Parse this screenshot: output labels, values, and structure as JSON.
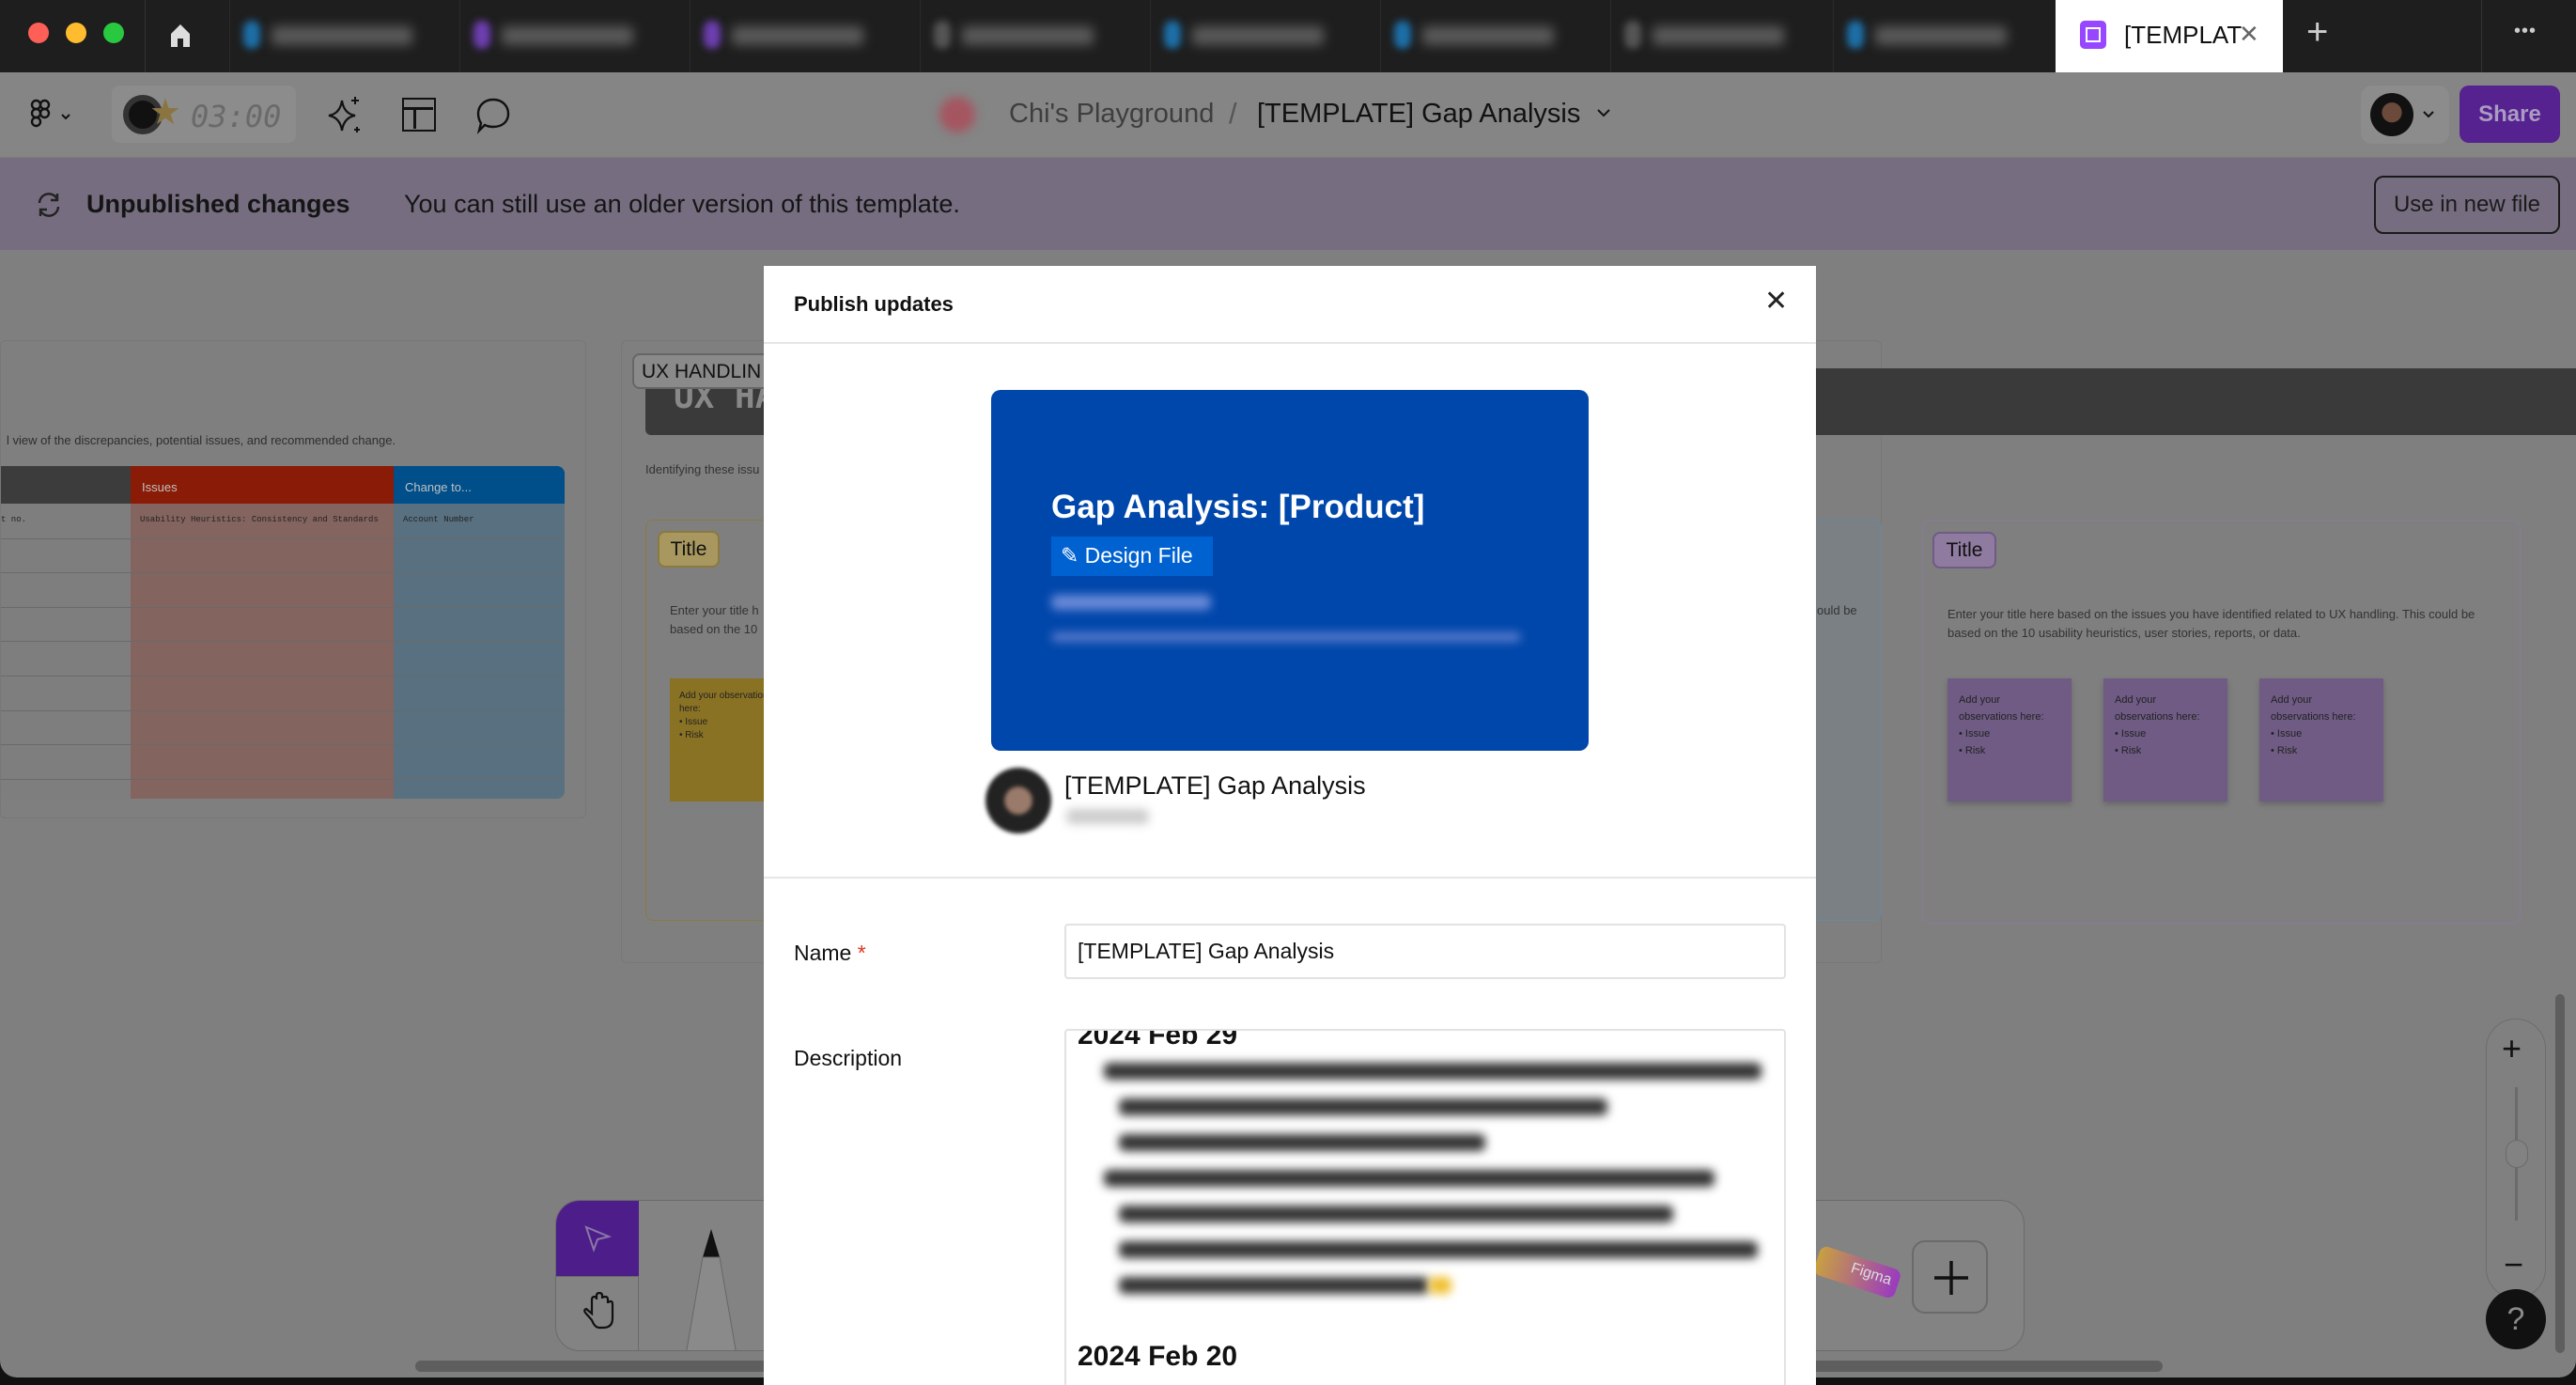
{
  "browser": {
    "active_tab": {
      "label": "[TEMPLAT",
      "close": "✕"
    },
    "new_tab": "+",
    "more": "•••"
  },
  "toolbar": {
    "timer": "03:00",
    "breadcrumb": {
      "team": "Chi's Playground",
      "separator": "/",
      "file": "[TEMPLATE] Gap Analysis"
    },
    "share_label": "Share"
  },
  "banner": {
    "title": "Unpublished changes",
    "message": "You can still use an older version of this template.",
    "use_button": "Use in new file"
  },
  "canvas": {
    "left_frame": {
      "subtitle": "l view of the discrepancies, potential issues, and recommended change.",
      "table": {
        "headers": [
          "",
          "Issues",
          "Change to..."
        ],
        "rows": [
          [
            "t no.",
            "Usability Heuristics: Consistency and Standards",
            "Account Number"
          ]
        ]
      }
    },
    "ux_frame": {
      "label": "UX HANDLIN",
      "header": "UX HA",
      "intro": "Identifying these issu",
      "card_title": "Title",
      "card_text_1": "Enter your title h",
      "card_text_2": "based on the 10",
      "sticky_text": "Add your observation here:",
      "bullets": [
        "Issue",
        "Risk"
      ],
      "right_fragment": "ould be"
    },
    "purple_card": {
      "title": "Title",
      "text": "Enter your title here based on the issues you have identified related to UX handling. This could be based on the 10 usability heuristics, user stories, reports, or data.",
      "stickies": [
        {
          "text": "Add your observations here:",
          "bullets": [
            "Issue",
            "Risk"
          ]
        },
        {
          "text": "Add your observations here:",
          "bullets": [
            "Issue",
            "Risk"
          ]
        },
        {
          "text": "Add your observations here:",
          "bullets": [
            "Issue",
            "Risk"
          ]
        }
      ]
    },
    "sticker_label": "Figma",
    "zoom_in": "+",
    "zoom_out": "−",
    "zoom_level": 0.5,
    "help": "?"
  },
  "modal": {
    "title": "Publish updates",
    "close": "✕",
    "preview": {
      "title": "Gap Analysis: [Product]",
      "badge": "Design File",
      "bg_color": "#0047ab"
    },
    "file_name": "[TEMPLATE] Gap Analysis",
    "name_label": "Name",
    "required_mark": "*",
    "name_value": "[TEMPLATE] Gap Analysis",
    "description_label": "Description",
    "description": {
      "entry_1_date": "2024 Feb 29",
      "entry_2_date": "2024 Feb 20"
    }
  },
  "colors": {
    "accent": "#5a2a9a",
    "required": "#e0361b",
    "issues": "#8a1b07",
    "change": "#004f8a"
  }
}
